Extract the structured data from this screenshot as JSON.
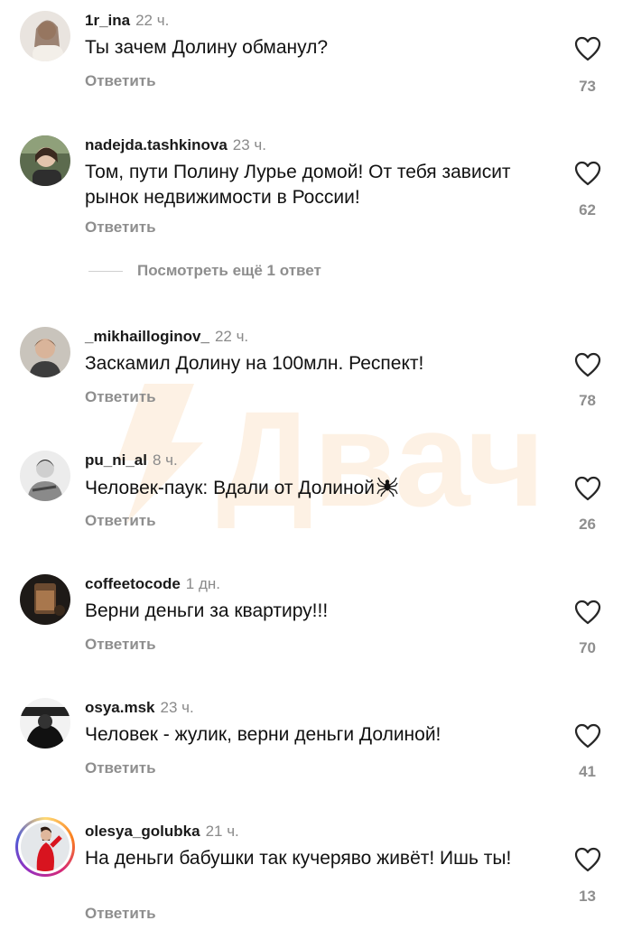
{
  "comments": [
    {
      "username": "1r_ina",
      "time": "22 ч.",
      "text": "Ты зачем Долину обманул?",
      "reply_label": "Ответить",
      "likes": "73"
    },
    {
      "username": "nadejda.tashkinova",
      "time": "23 ч.",
      "text": "Том, пути Полину Лурье домой! От тебя зависит рынок недвижимости в России!",
      "reply_label": "Ответить",
      "likes": "62"
    },
    {
      "username": "_mikhailloginov_",
      "time": "22 ч.",
      "text": "Заскамил Долину на 100млн. Респект!",
      "reply_label": "Ответить",
      "likes": "78"
    },
    {
      "username": "pu_ni_al",
      "time": "8 ч.",
      "text": "Человек-паук: Вдали от Долиной",
      "reply_label": "Ответить",
      "likes": "26"
    },
    {
      "username": "coffeetocode",
      "time": "1 дн.",
      "text": "Верни деньги за квартиру!!!",
      "reply_label": "Ответить",
      "likes": "70"
    },
    {
      "username": "osya.msk",
      "time": "23 ч.",
      "text": "Человек - жулик, верни деньги Долиной!",
      "reply_label": "Ответить",
      "likes": "41"
    },
    {
      "username": "olesya_golubka",
      "time": "21 ч.",
      "text": "На деньги бабушки так кучеряво живёт! Ишь ты!",
      "reply_label": "Ответить",
      "likes": "13"
    }
  ],
  "view_more": "Посмотреть ещё 1 ответ",
  "watermark": "Двач",
  "icons": {
    "like": "heart-outline-icon",
    "spider": "spider-emoji"
  },
  "colors": {
    "secondary_text": "#8e8e8e",
    "primary_text": "#111111",
    "watermark": "#fdf0e3"
  }
}
